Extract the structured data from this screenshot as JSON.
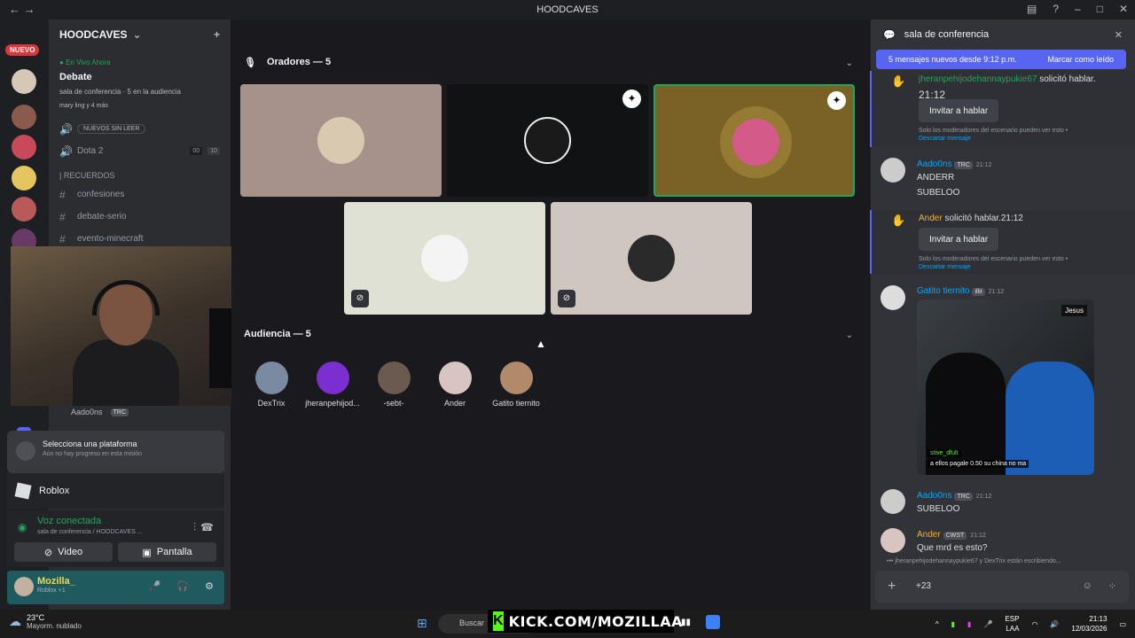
{
  "window": {
    "title": "HOODCAVES"
  },
  "guilds": {
    "nuevo_badge": "NUEVO"
  },
  "server": {
    "name": "HOODCAVES",
    "live": {
      "tag": "En Vivo Ahora",
      "name": "Debate",
      "channel": "sala de conferencia",
      "audience": "5 en la audiencia",
      "people": "mary ling y 4 más"
    },
    "unread_pill": "NUEVOS SIN LEER",
    "channels": [
      {
        "name": "Dota 2",
        "counts": [
          "00",
          "10"
        ]
      }
    ],
    "category": "| RECUERDOS",
    "text_channels": [
      "confesiones",
      "debate-serio",
      "evento-minecraft"
    ],
    "voice_user": {
      "name": "Aado0ns",
      "tag": "TRC"
    }
  },
  "quest": {
    "title": "Selecciona una plataforma",
    "subtitle": "Aún no hay progreso en esta misión"
  },
  "activity": {
    "game": "Roblox"
  },
  "voice_panel": {
    "status": "Voz conectada",
    "location": "sala de conferencia / HOODCAVES ...",
    "video_label": "Video",
    "screen_label": "Pantalla"
  },
  "self": {
    "name": "Mozilla_",
    "status": "Roblox +1"
  },
  "stage": {
    "speakers_title": "Oradores — 5",
    "audience_title": "Audiencia — 5",
    "audience": [
      "DexTrix",
      "jheranpehijod...",
      "-sebt-",
      "Ander",
      "Gatito tiernito"
    ]
  },
  "chat": {
    "channel": "sala de conferencia",
    "new_messages": "5 mensajes nuevos desde 9:12 p.m.",
    "mark_read": "Marcar como leído",
    "requests": [
      {
        "user": "jheranpehijodehannaypukie67",
        "action": "solicitó hablar.",
        "time": "21:12",
        "invite": "Invitar a hablar",
        "note": "Solo los moderadores del escenario pueden ver esto •",
        "dismiss": "Descartar mensaje"
      },
      {
        "user": "Ander",
        "action": "solicitó hablar.",
        "time": "21:12",
        "invite": "Invitar a hablar",
        "note": "Solo los moderadores del escenario pueden ver esto •",
        "dismiss": "Descartar mensaje"
      }
    ],
    "messages": [
      {
        "user": "Aado0ns",
        "tag": "TRC",
        "time": "21:12",
        "lines": [
          "ANDERR",
          "SUBELOO"
        ]
      },
      {
        "user": "Gatito tiernito",
        "tag": "illit",
        "time": "21:12"
      },
      {
        "user": "Aado0ns",
        "tag": "TRC",
        "time": "21:12",
        "lines": [
          "SUBELOO"
        ]
      },
      {
        "user": "Ander",
        "tag": "CWST",
        "time": "21:12",
        "lines": [
          "Que mrd es esto?"
        ]
      }
    ],
    "image": {
      "stamp": "Jesus",
      "caption_user": "stive_dfult",
      "caption": "a ellos pagale 0.50 su china no ma"
    },
    "typing": "jheranpehijodehannaypukie67 y DexTrix están escribiendo...",
    "composer_value": "+23"
  },
  "overlay": {
    "kick": "KICK.COM/MOZILLAA"
  },
  "taskbar": {
    "temp": "23°C",
    "weather": "Mayorm. nublado",
    "search": "Buscar",
    "lang": "ESP",
    "lang2": "LAA",
    "time": "21:13",
    "date": "12/03/2026"
  },
  "colors": {
    "accent": "#5865f2",
    "green": "#23a55a",
    "kick": "#53fc18"
  }
}
